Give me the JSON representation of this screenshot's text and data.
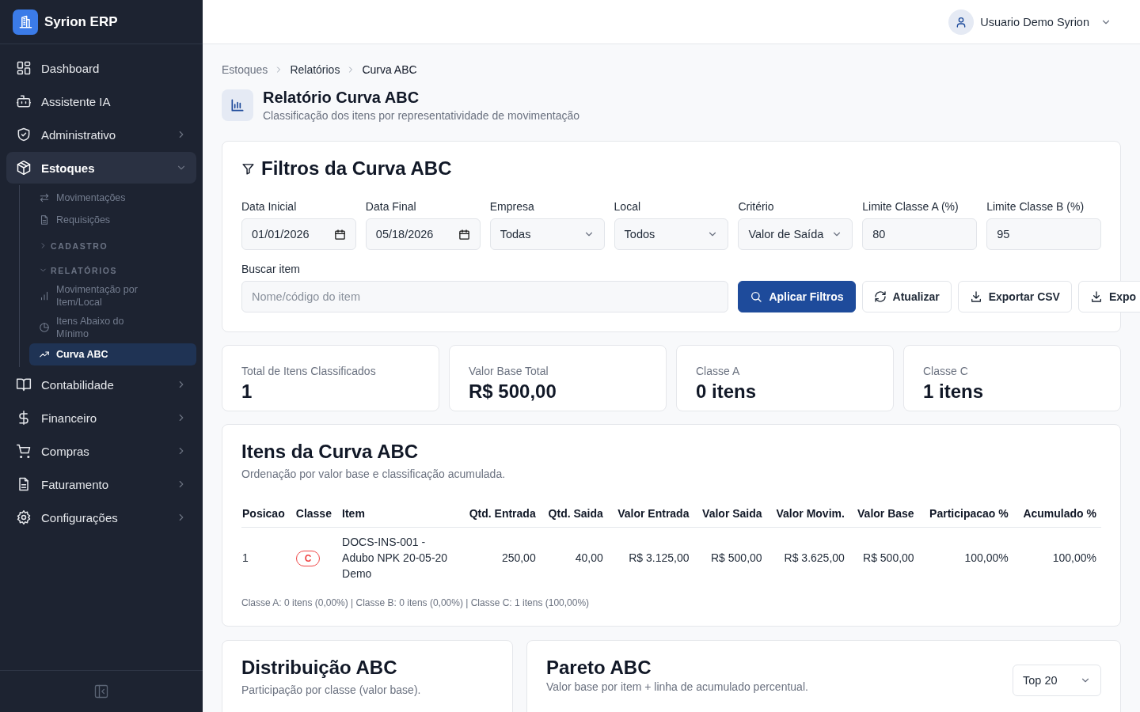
{
  "brand": {
    "name": "Syrion ERP"
  },
  "sidebar": {
    "items": [
      {
        "kind": "link",
        "label": "Dashboard",
        "selected": false
      },
      {
        "kind": "link",
        "label": "Assistente IA",
        "selected": false
      },
      {
        "kind": "group",
        "label": "Administrativo",
        "selected": false,
        "expanded": false
      },
      {
        "kind": "group",
        "label": "Estoques",
        "selected": true,
        "expanded": true,
        "children": [
          {
            "kind": "link",
            "label": "Movimentações",
            "selected": false
          },
          {
            "kind": "link",
            "label": "Requisições",
            "selected": false
          },
          {
            "kind": "section",
            "label": "CADASTRO",
            "expanded": false
          },
          {
            "kind": "section",
            "label": "RELATÓRIOS",
            "expanded": true,
            "children": [
              {
                "kind": "link",
                "label": "Movimentação por Item/Local",
                "selected": false
              },
              {
                "kind": "link",
                "label": "Itens Abaixo do Mínimo",
                "selected": false
              },
              {
                "kind": "link",
                "label": "Curva ABC",
                "selected": true
              }
            ]
          }
        ]
      },
      {
        "kind": "group",
        "label": "Contabilidade",
        "selected": false,
        "expanded": false
      },
      {
        "kind": "group",
        "label": "Financeiro",
        "selected": false,
        "expanded": false
      },
      {
        "kind": "group",
        "label": "Compras",
        "selected": false,
        "expanded": false
      },
      {
        "kind": "group",
        "label": "Faturamento",
        "selected": false,
        "expanded": false
      },
      {
        "kind": "group",
        "label": "Configurações",
        "selected": false,
        "expanded": false
      }
    ]
  },
  "user": {
    "name": "Usuario Demo Syrion"
  },
  "breadcrumb": [
    "Estoques",
    "Relatórios",
    "Curva ABC"
  ],
  "page": {
    "title": "Relatório Curva ABC",
    "subtitle": "Classificação dos itens por representatividade de movimentação"
  },
  "filters": {
    "title": "Filtros da Curva ABC",
    "fields": [
      {
        "kind": "date",
        "label": "Data Inicial",
        "value": "01/01/2026"
      },
      {
        "kind": "date",
        "label": "Data Final",
        "value": "05/18/2026"
      },
      {
        "kind": "select",
        "label": "Empresa",
        "value": "Todas"
      },
      {
        "kind": "select",
        "label": "Local",
        "value": "Todos"
      },
      {
        "kind": "select",
        "label": "Critério",
        "value": "Valor de Saída"
      },
      {
        "kind": "number",
        "label": "Limite Classe A (%)",
        "value": "80"
      },
      {
        "kind": "number",
        "label": "Limite Classe B (%)",
        "value": "95"
      }
    ],
    "search": {
      "label": "Buscar item",
      "placeholder": "Nome/código do item"
    },
    "buttons": [
      {
        "kind": "primary",
        "label": "Aplicar Filtros"
      },
      {
        "kind": "default",
        "label": "Atualizar"
      },
      {
        "kind": "default",
        "label": "Exportar CSV"
      },
      {
        "kind": "default",
        "label": "Expo"
      }
    ]
  },
  "stats": [
    {
      "label": "Total de Itens Classificados",
      "value": "1"
    },
    {
      "label": "Valor Base Total",
      "value": "R$ 500,00"
    },
    {
      "label": "Classe A",
      "value": "0 itens"
    },
    {
      "label": "Classe C",
      "value": "1 itens"
    }
  ],
  "table": {
    "title": "Itens da Curva ABC",
    "subtitle": "Ordenação por valor base e classificação acumulada.",
    "columns": [
      "Posicao",
      "Classe",
      "Item",
      "Qtd. Entrada",
      "Qtd. Saida",
      "Valor Entrada",
      "Valor Saida",
      "Valor Movim.",
      "Valor Base",
      "Participacao %",
      "Acumulado %"
    ],
    "rows": [
      {
        "cells": [
          "1",
          "C",
          "DOCS-INS-001 - Adubo NPK 20-05-20 Demo",
          "250,00",
          "40,00",
          "R$ 3.125,00",
          "R$ 500,00",
          "R$ 3.625,00",
          "R$ 500,00",
          "100,00%",
          "100,00%"
        ],
        "color": "#ef4444"
      }
    ],
    "summary": "Classe A: 0 itens (0,00%) | Classe B: 0 itens (0,00%) | Classe C: 1 itens (100,00%)"
  },
  "distribution": {
    "title": "Distribuição ABC",
    "subtitle": "Participação por classe (valor base)."
  },
  "pareto": {
    "title": "Pareto ABC",
    "subtitle": "Valor base por item + linha de acumulado percentual.",
    "select": {
      "value": "Top 20"
    }
  }
}
